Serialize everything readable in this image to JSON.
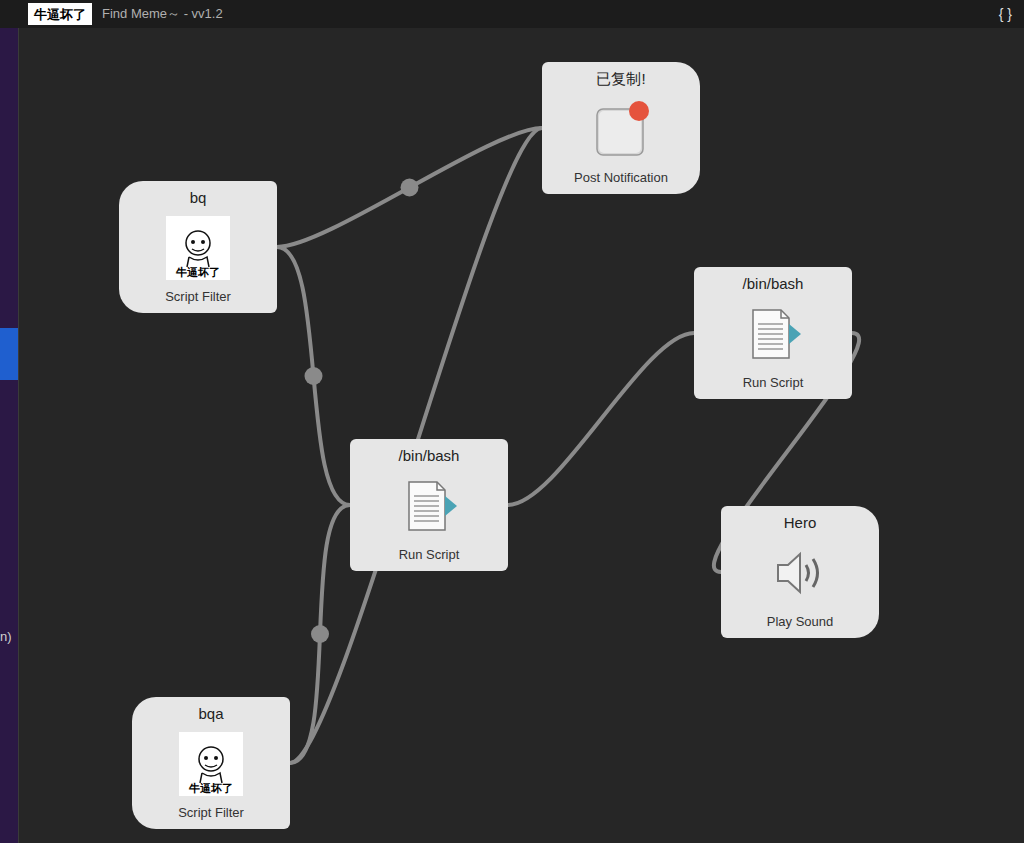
{
  "window": {
    "title": "Find Meme～ - vv1.2",
    "logo_caption": "牛逼坏了",
    "toolbar_fragment": "{ }"
  },
  "sidebar": {
    "fragment": "n)",
    "highlighted": true
  },
  "nodes": [
    {
      "kind": "script_filter",
      "title": "bq",
      "label": "Script Filter",
      "icon_caption": "牛逼坏了"
    },
    {
      "kind": "notification",
      "title": "已复制!",
      "label": "Post Notification"
    },
    {
      "kind": "run_script",
      "title": "/bin/bash",
      "label": "Run Script"
    },
    {
      "kind": "run_script",
      "title": "/bin/bash",
      "label": "Run Script"
    },
    {
      "kind": "sound",
      "title": "Hero",
      "label": "Play Sound"
    },
    {
      "kind": "script_filter",
      "title": "bqa",
      "label": "Script Filter",
      "icon_caption": "牛逼坏了"
    }
  ],
  "connections": [
    {
      "from": 0,
      "to": 1,
      "dot": true
    },
    {
      "from": 0,
      "to": 2,
      "dot": true
    },
    {
      "from": 5,
      "to": 2,
      "dot": true
    },
    {
      "from": 5,
      "to": 1,
      "dot": false
    },
    {
      "from": 2,
      "to": 3,
      "dot": false
    },
    {
      "from": 3,
      "to": 4,
      "dot": false
    }
  ]
}
